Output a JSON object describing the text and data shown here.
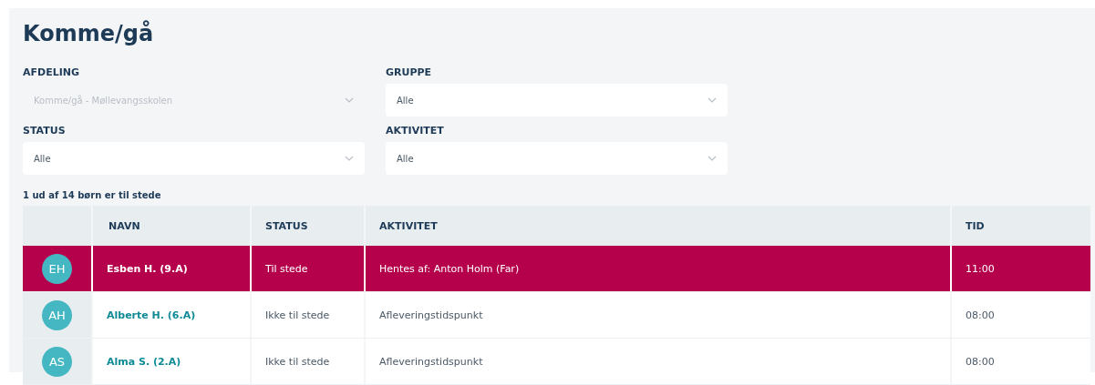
{
  "title": "Komme/gå",
  "filters": [
    {
      "label": "AFDELING",
      "value": "Komme/gå - Møllevangsskolen",
      "disabled": true
    },
    {
      "label": "GRUPPE",
      "value": "Alle",
      "disabled": false
    },
    {
      "label": "STATUS",
      "value": "Alle",
      "disabled": false
    },
    {
      "label": "AKTIVITET",
      "value": "Alle",
      "disabled": false
    }
  ],
  "summary": "1 ud af 14 børn er til stede",
  "table": {
    "columns": [
      "NAVN",
      "STATUS",
      "AKTIVITET",
      "TID"
    ],
    "rows": [
      {
        "initials": "EH",
        "name": "Esben H. (9.A)",
        "status": "Til stede",
        "activity": "Hentes af: Anton Holm (Far)",
        "time": "11:00",
        "selected": true
      },
      {
        "initials": "AH",
        "name": "Alberte H. (6.A)",
        "status": "Ikke til stede",
        "activity": "Afleveringstidspunkt",
        "time": "08:00",
        "selected": false
      },
      {
        "initials": "AS",
        "name": "Alma S. (2.A)",
        "status": "Ikke til stede",
        "activity": "Afleveringstidspunkt",
        "time": "08:00",
        "selected": false
      }
    ]
  }
}
